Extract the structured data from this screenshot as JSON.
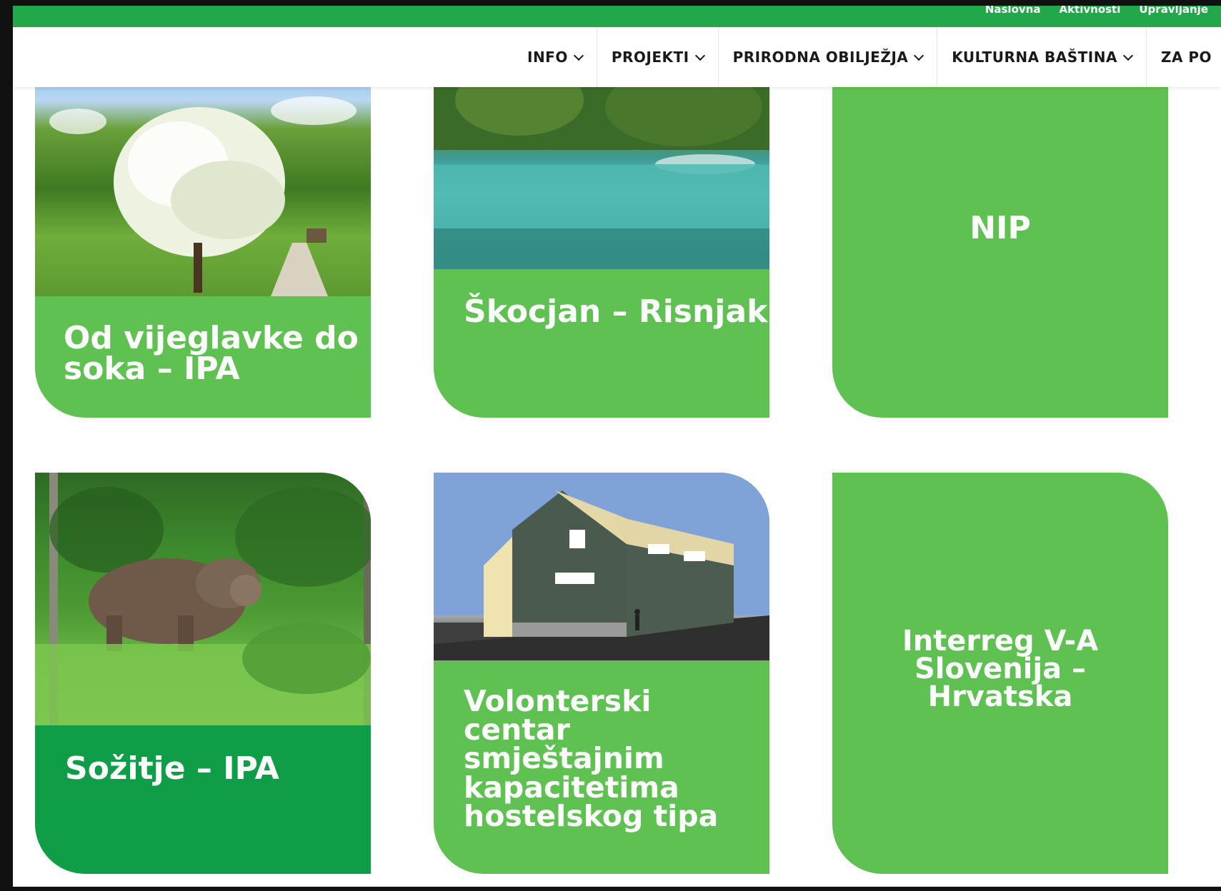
{
  "topbar": {
    "links": [
      "Naslovna",
      "Aktivnosti",
      "Upravljanje"
    ]
  },
  "nav": {
    "items": [
      {
        "label": "INFO"
      },
      {
        "label": "PROJEKTI"
      },
      {
        "label": "PRIRODNA OBILJEŽJA"
      },
      {
        "label": "KULTURNA BAŠTINA"
      },
      {
        "label": "ZA PO"
      }
    ]
  },
  "cards": [
    {
      "title": "Od vijeglavke do soka – IPA",
      "title_lines": [
        "Od vijeglavke do",
        "soka – IPA"
      ],
      "image": "tree-meadow-photo"
    },
    {
      "title": "Škocjan – Risnjak",
      "image": "river-photo"
    },
    {
      "title": "NIP"
    },
    {
      "title": "Sožitje – IPA",
      "image": "bear-photo"
    },
    {
      "title": "Volonterski centar smještajnim kapacitetima hostelskog tipa",
      "title_lines": [
        "Volonterski",
        "centar",
        "smještajnim",
        "kapacitetima",
        "hostelskog tipa"
      ],
      "image": "building-render"
    },
    {
      "title": "Interreg V-A Slovenija – Hrvatska",
      "title_lines": [
        "Interreg V-A",
        "Slovenija –",
        "Hrvatska"
      ]
    }
  ],
  "colors": {
    "topbar": "#22a84a",
    "card_green": "#5ec152",
    "card_dark_green": "#0f9d48",
    "nav_text": "#1a1a1a"
  }
}
